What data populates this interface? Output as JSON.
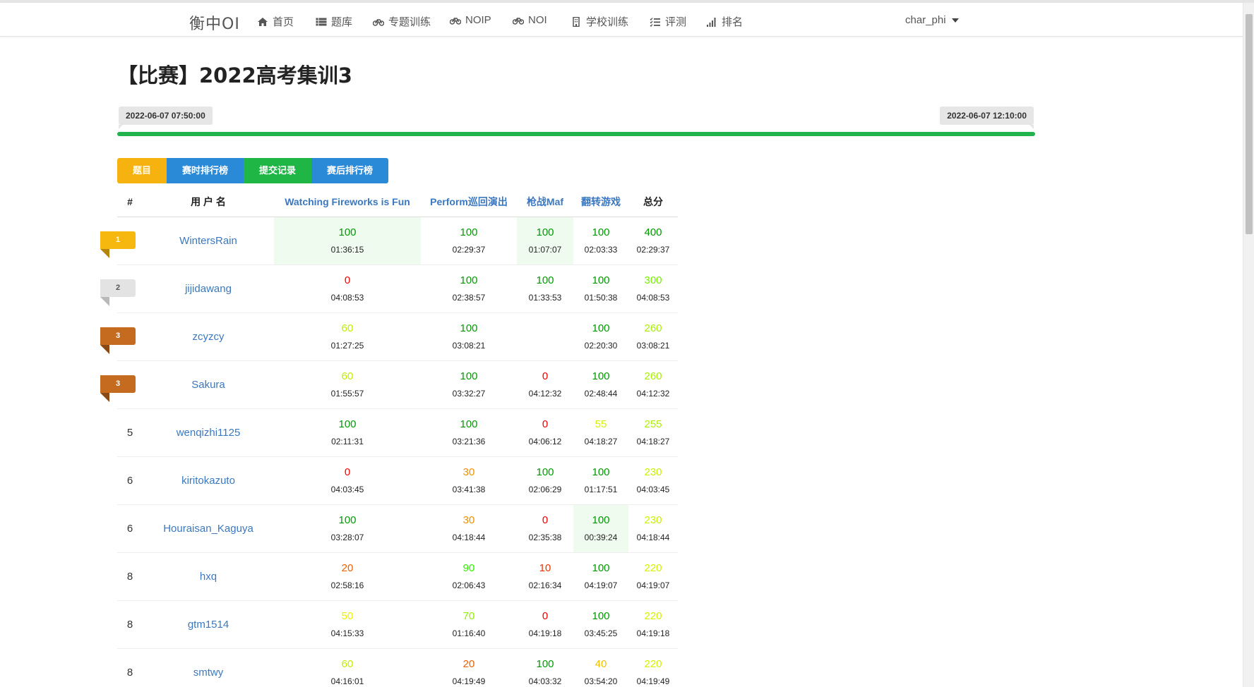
{
  "nav": {
    "brand": "衡中OI",
    "items": [
      "首页",
      "题库",
      "专题训练",
      "NOIP",
      "NOI",
      "学校训练",
      "评测",
      "排名"
    ],
    "user": "char_phi"
  },
  "contest": {
    "title": "【比赛】2022高考集训3",
    "start_time": "2022-06-07 07:50:00",
    "end_time": "2022-06-07 12:10:00",
    "progress_fraction": 1.0,
    "progress_color": "#21b34b"
  },
  "buttons": [
    {
      "label": "题目",
      "color": "#f6b20f"
    },
    {
      "label": "赛时排行榜",
      "color": "#2a8ad8"
    },
    {
      "label": "提交记录",
      "color": "#1fb646"
    },
    {
      "label": "赛后排行榜",
      "color": "#2a8ad8"
    }
  ],
  "table": {
    "headers": [
      "#",
      "用 户 名",
      "Watching Fireworks is Fun",
      "Perform巡回演出",
      "枪战Maf",
      "翻转游戏",
      "总分"
    ],
    "rows": [
      {
        "rank": "1",
        "medal": "gold",
        "user": "WintersRain",
        "cells": [
          {
            "s": "100",
            "t": "01:36:15",
            "first": true
          },
          {
            "s": "100",
            "t": "02:29:37"
          },
          {
            "s": "100",
            "t": "01:07:07",
            "first": true
          },
          {
            "s": "100",
            "t": "02:03:33"
          },
          {
            "s": "400",
            "t": "02:29:37"
          }
        ]
      },
      {
        "rank": "2",
        "medal": "silver",
        "user": "jijidawang",
        "cells": [
          {
            "s": "0",
            "t": "04:08:53"
          },
          {
            "s": "100",
            "t": "02:38:57"
          },
          {
            "s": "100",
            "t": "01:33:53"
          },
          {
            "s": "100",
            "t": "01:50:38"
          },
          {
            "s": "300",
            "t": "04:08:53"
          }
        ]
      },
      {
        "rank": "3",
        "medal": "bronze",
        "user": "zcyzcy",
        "cells": [
          {
            "s": "60",
            "t": "01:27:25"
          },
          {
            "s": "100",
            "t": "03:08:21"
          },
          {
            "s": "",
            "t": ""
          },
          {
            "s": "100",
            "t": "02:20:30"
          },
          {
            "s": "260",
            "t": "03:08:21"
          }
        ]
      },
      {
        "rank": "3",
        "medal": "bronze",
        "user": "Sakura",
        "cells": [
          {
            "s": "60",
            "t": "01:55:57"
          },
          {
            "s": "100",
            "t": "03:32:27"
          },
          {
            "s": "0",
            "t": "04:12:32"
          },
          {
            "s": "100",
            "t": "02:48:44"
          },
          {
            "s": "260",
            "t": "04:12:32"
          }
        ]
      },
      {
        "rank": "5",
        "medal": "",
        "user": "wenqizhi1125",
        "cells": [
          {
            "s": "100",
            "t": "02:11:31"
          },
          {
            "s": "100",
            "t": "03:21:36"
          },
          {
            "s": "0",
            "t": "04:06:12"
          },
          {
            "s": "55",
            "t": "04:18:27"
          },
          {
            "s": "255",
            "t": "04:18:27"
          }
        ]
      },
      {
        "rank": "6",
        "medal": "",
        "user": "kiritokazuto",
        "cells": [
          {
            "s": "0",
            "t": "04:03:45"
          },
          {
            "s": "30",
            "t": "03:41:38"
          },
          {
            "s": "100",
            "t": "02:06:29"
          },
          {
            "s": "100",
            "t": "01:17:51"
          },
          {
            "s": "230",
            "t": "04:03:45"
          }
        ]
      },
      {
        "rank": "6",
        "medal": "",
        "user": "Houraisan_Kaguya",
        "cells": [
          {
            "s": "100",
            "t": "03:28:07"
          },
          {
            "s": "30",
            "t": "04:18:44"
          },
          {
            "s": "0",
            "t": "02:35:38"
          },
          {
            "s": "100",
            "t": "00:39:24",
            "first": true
          },
          {
            "s": "230",
            "t": "04:18:44"
          }
        ]
      },
      {
        "rank": "8",
        "medal": "",
        "user": "hxq",
        "cells": [
          {
            "s": "20",
            "t": "02:58:16"
          },
          {
            "s": "90",
            "t": "02:06:43"
          },
          {
            "s": "10",
            "t": "02:16:34"
          },
          {
            "s": "100",
            "t": "04:19:07"
          },
          {
            "s": "220",
            "t": "04:19:07"
          }
        ]
      },
      {
        "rank": "8",
        "medal": "",
        "user": "gtm1514",
        "cells": [
          {
            "s": "50",
            "t": "04:15:33"
          },
          {
            "s": "70",
            "t": "01:16:40"
          },
          {
            "s": "0",
            "t": "04:19:18"
          },
          {
            "s": "100",
            "t": "03:45:25"
          },
          {
            "s": "220",
            "t": "04:19:18"
          }
        ]
      },
      {
        "rank": "8",
        "medal": "",
        "user": "smtwy",
        "cells": [
          {
            "s": "60",
            "t": "04:16:01"
          },
          {
            "s": "20",
            "t": "04:19:49"
          },
          {
            "s": "100",
            "t": "04:03:32"
          },
          {
            "s": "40",
            "t": "03:54:20"
          },
          {
            "s": "220",
            "t": "04:19:49"
          }
        ]
      }
    ]
  },
  "medal_colors": {
    "gold": "#f6b80f",
    "silver": "#e3e3e3",
    "bronze": "#c46b1f"
  }
}
